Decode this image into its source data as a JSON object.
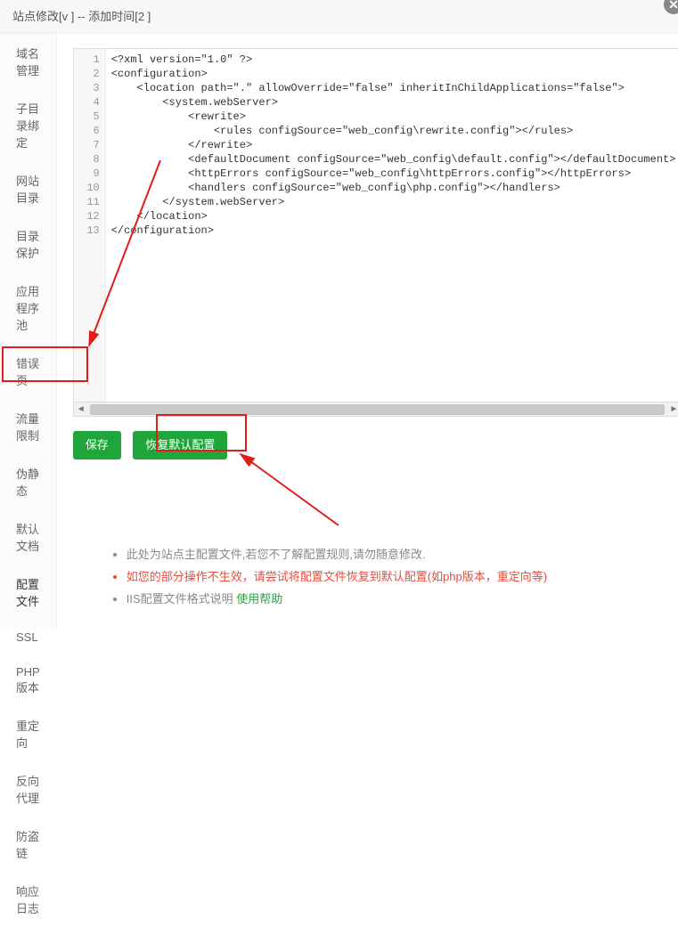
{
  "header": {
    "title": "站点修改[v                     ] -- 添加时间[2                              ]"
  },
  "sidebar": {
    "items": [
      {
        "label": "域名管理"
      },
      {
        "label": "子目录绑定"
      },
      {
        "label": "网站目录"
      },
      {
        "label": "目录保护"
      },
      {
        "label": "应用程序池"
      },
      {
        "label": "错误页"
      },
      {
        "label": "流量限制"
      },
      {
        "label": "伪静态"
      },
      {
        "label": "默认文档"
      },
      {
        "label": "配置文件",
        "active": true
      },
      {
        "label": "SSL"
      },
      {
        "label": "PHP版本"
      },
      {
        "label": "重定向"
      },
      {
        "label": "反向代理"
      },
      {
        "label": "防盗链"
      },
      {
        "label": "响应日志"
      }
    ]
  },
  "editor": {
    "lines": [
      "<?xml version=\"1.0\" ?>",
      "<configuration>",
      "    <location path=\".\" allowOverride=\"false\" inheritInChildApplications=\"false\">",
      "        <system.webServer>",
      "            <rewrite>",
      "                <rules configSource=\"web_config\\rewrite.config\"></rules>",
      "            </rewrite>",
      "            <defaultDocument configSource=\"web_config\\default.config\"></defaultDocument>",
      "            <httpErrors configSource=\"web_config\\httpErrors.config\"></httpErrors>",
      "            <handlers configSource=\"web_config\\php.config\"></handlers>",
      "        </system.webServer>",
      "    </location>",
      "</configuration>"
    ]
  },
  "buttons": {
    "save": "保存",
    "restore": "恢复默认配置"
  },
  "notes": {
    "n1": "此处为站点主配置文件,若您不了解配置规则,请勿随意修改.",
    "n2": "如您的部分操作不生效，请尝试将配置文件恢复到默认配置(如php版本，重定向等)",
    "n3a": "IIS配置文件格式说明 ",
    "n3b": "使用帮助"
  }
}
